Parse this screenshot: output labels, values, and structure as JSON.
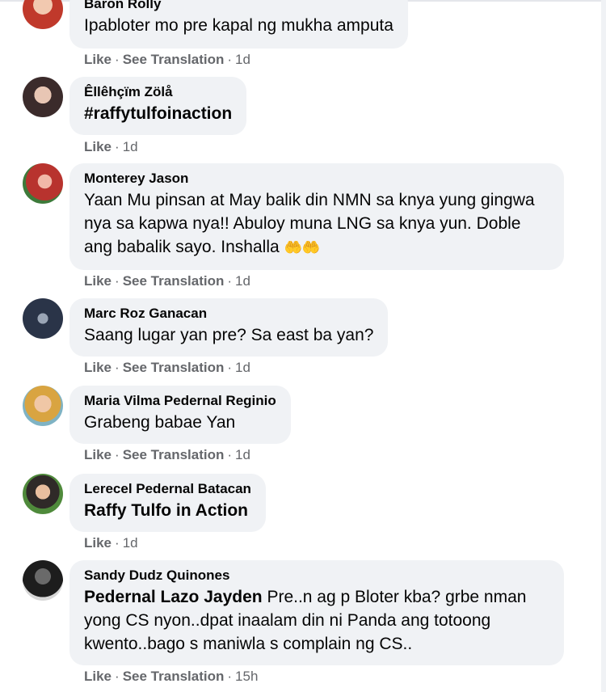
{
  "comments": [
    {
      "author": "Baron Rolly",
      "text": "Ipabloter mo pre kapal ng mukha amputa",
      "actions": {
        "like": "Like",
        "translate": "See Translation",
        "time": "1d"
      }
    },
    {
      "author": "Êllêhçïm Zölå",
      "text": "#raffytulfoinaction",
      "actions": {
        "like": "Like",
        "time": "1d"
      }
    },
    {
      "author": "Monterey Jason",
      "text": "Yaan Mu pinsan at May balik din NMN sa knya yung gingwa nya sa kapwa nya!! Abuloy muna LNG sa knya yun. Doble ang babalik sayo. Inshalla",
      "emoji": "🤲🤲",
      "actions": {
        "like": "Like",
        "translate": "See Translation",
        "time": "1d"
      }
    },
    {
      "author": "Marc Roz Ganacan",
      "text": "Saang lugar yan pre? Sa east ba yan?",
      "actions": {
        "like": "Like",
        "translate": "See Translation",
        "time": "1d"
      }
    },
    {
      "author": "Maria Vilma Pedernal Reginio",
      "text": "Grabeng babae Yan",
      "actions": {
        "like": "Like",
        "translate": "See Translation",
        "time": "1d"
      }
    },
    {
      "author": "Lerecel Pedernal Batacan",
      "text": "Raffy Tulfo in Action",
      "actions": {
        "like": "Like",
        "time": "1d"
      }
    },
    {
      "author": "Sandy Dudz Quinones",
      "mention": "Pedernal Lazo Jayden",
      "text": "Pre..n ag p Bloter kba? grbe nman yong CS nyon..dpat inaalam din ni Panda ang totoong kwento..bago s maniwla s complain ng CS..",
      "actions": {
        "like": "Like",
        "translate": "See Translation",
        "time": "15h"
      }
    }
  ],
  "separator": "·",
  "colors": {
    "bubble": "#f0f2f5",
    "text": "#050505",
    "secondary": "#65676b"
  }
}
